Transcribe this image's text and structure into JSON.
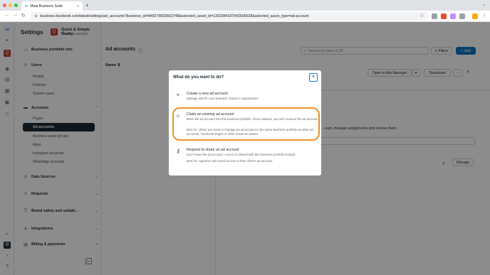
{
  "browser": {
    "tab_title": "Meta Business Suite",
    "tab_close": "×",
    "new_tab": "+",
    "url": "business.facebook.com/latest/settings/ad_accounts?business_id=849279833663748&selected_asset_id=1202084197043506628&selected_asset_type=ad-account"
  },
  "settings": {
    "title": "Settings",
    "business_initial": "Q",
    "business_name": "Quick & Simple Realty",
    "business_type": "Business portfolio"
  },
  "sidebar": {
    "portfolio_info": "Business portfolio info",
    "users": "Users",
    "users_items": [
      "People",
      "Partners",
      "System users"
    ],
    "accounts": "Accounts",
    "accounts_items": [
      "Pages",
      "Ad accounts",
      "Business asset groups",
      "Apps",
      "Instagram accounts",
      "WhatsApp accounts"
    ],
    "data_sources": "Data Sources",
    "requests": "Requests",
    "brand_safety": "Brand safety and suitabi...",
    "integrations": "Integrations",
    "billing": "Billing & payments"
  },
  "main": {
    "title": "Ad accounts",
    "search_placeholder": "Search by name or ID",
    "filters": "Filters",
    "add": "Add",
    "name_col": "Name",
    "open_ads_manager": "Open in Ads Manager",
    "deactivate": "Deactivate",
    "more": "···",
    "background_text": "...ount, manage assignments and remove them.",
    "manage": "Manage"
  },
  "modal": {
    "title": "What do you want to do?",
    "close": "×",
    "options": [
      {
        "title": "Create a new ad account",
        "desc": "Manage ads for your business, brand or organization."
      },
      {
        "title": "Claim an existing ad account",
        "desc": "Move the ad account into this business portfolio. Once claimed, you can't remove the ad account.",
        "best": "Best for: When you need to manage an ad account in the same business portfolio as other ad accounts, Facebook Pages or other business assets."
      },
      {
        "title": "Request to share an ad account",
        "desc": "Don't move the ad account. Access is shared with this business portfolio instead.",
        "best": "Best for: Agencies who need access to their client's ad account."
      }
    ]
  },
  "colors": {
    "highlight": "#e8922a",
    "primary_blue": "#0a78be",
    "sidebar_active": "#1c2b33",
    "business_avatar": "#b8412f"
  }
}
